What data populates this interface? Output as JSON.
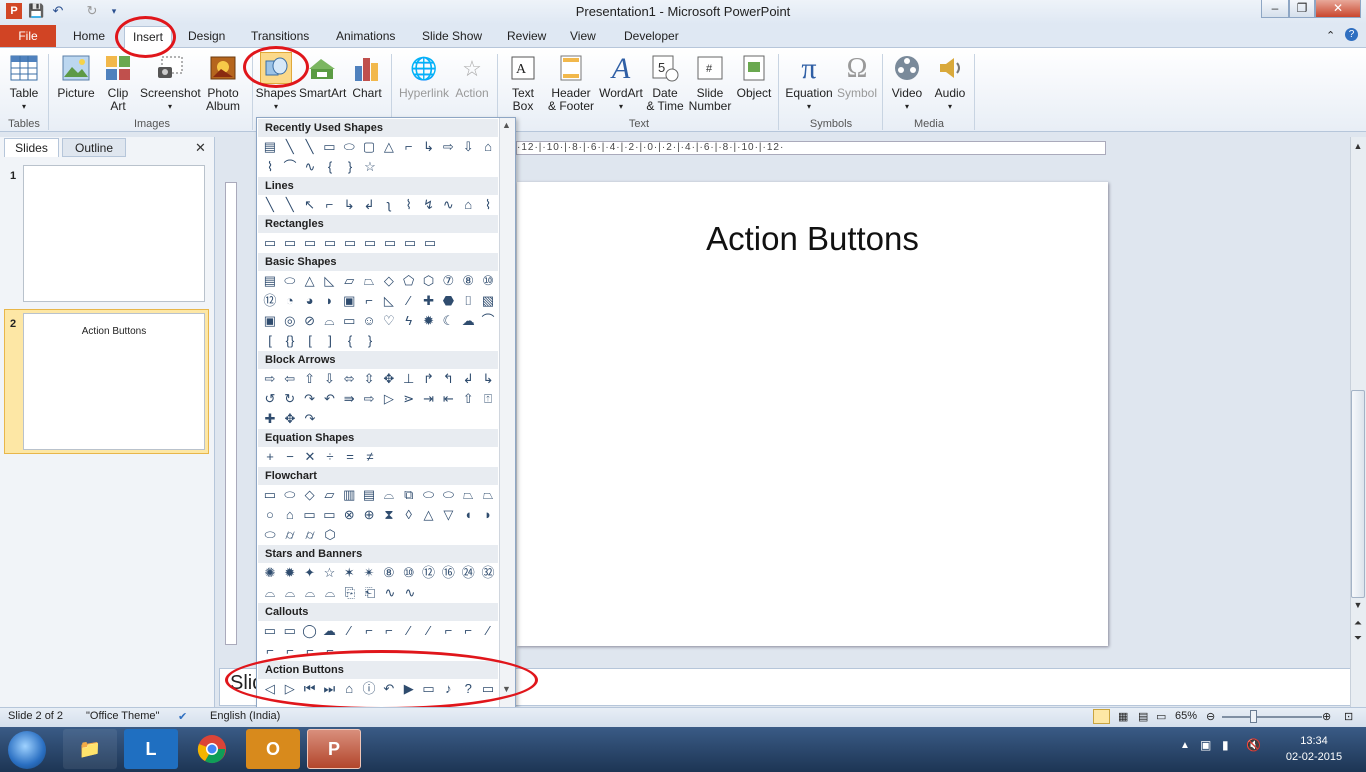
{
  "window": {
    "title": "Presentation1  -  Microsoft PowerPoint",
    "controls": [
      "–",
      "❐",
      "✕"
    ]
  },
  "tabs": [
    "File",
    "Home",
    "Insert",
    "Design",
    "Transitions",
    "Animations",
    "Slide Show",
    "Review",
    "View",
    "Developer"
  ],
  "ribbon": {
    "tables": {
      "label": "Table",
      "group": "Tables"
    },
    "images": {
      "picture": "Picture",
      "clipart_1": "Clip",
      "clipart_2": "Art",
      "screenshot": "Screenshot",
      "photo_1": "Photo",
      "photo_2": "Album",
      "group": "Images"
    },
    "illustrations": {
      "shapes": "Shapes",
      "smartart": "SmartArt",
      "chart": "Chart"
    },
    "links": {
      "hyperlink": "Hyperlink",
      "action": "Action"
    },
    "text": {
      "textbox_1": "Text",
      "textbox_2": "Box",
      "header_1": "Header",
      "header_2": "& Footer",
      "wordart": "WordArt",
      "date_1": "Date",
      "date_2": "& Time",
      "slidenum_1": "Slide",
      "slidenum_2": "Number",
      "object": "Object",
      "group": "Text"
    },
    "symbols": {
      "equation": "Equation",
      "symbol": "Symbol",
      "group": "Symbols"
    },
    "media": {
      "video": "Video",
      "audio": "Audio",
      "group": "Media"
    }
  },
  "shapes_menu": {
    "sections": {
      "recent": "Recently Used Shapes",
      "lines": "Lines",
      "rectangles": "Rectangles",
      "basic": "Basic Shapes",
      "block_arrows": "Block Arrows",
      "equation": "Equation Shapes",
      "flowchart": "Flowchart",
      "stars": "Stars and Banners",
      "callouts": "Callouts",
      "action": "Action Buttons"
    },
    "glyph_rows": {
      "recent_1": [
        "▤",
        "╲",
        "╲",
        "▭",
        "⬭",
        "▢",
        "△",
        "⌐",
        "↳",
        "⇨",
        "⇩",
        "⌂"
      ],
      "recent_2": [
        "⌇",
        "⌒",
        "∿",
        "{",
        "}",
        "☆"
      ],
      "lines_1": [
        "╲",
        "╲",
        "↖",
        "⌐",
        "↳",
        "↲",
        "ʅ",
        "⌇",
        "↯",
        "∿",
        "⌂",
        "⌇"
      ],
      "rect_1": [
        "▭",
        "▭",
        "▭",
        "▭",
        "▭",
        "▭",
        "▭",
        "▭",
        "▭"
      ],
      "basic_1": [
        "▤",
        "⬭",
        "△",
        "◺",
        "▱",
        "⏢",
        "◇",
        "⬠",
        "⬡",
        "⑦",
        "⑧",
        "⑩"
      ],
      "basic_2": [
        "⑫",
        "◔",
        "◕",
        "◗",
        "▣",
        "⌐",
        "◺",
        "⁄",
        "✚",
        "⬣",
        "⌷",
        "▧"
      ],
      "basic_3": [
        "▣",
        "◎",
        "⊘",
        "⌓",
        "▭",
        "☺",
        "♡",
        "ϟ",
        "✹",
        "☾",
        "☁",
        "⌒"
      ],
      "basic_4": [
        "[",
        "{}",
        "[",
        "]",
        "{",
        "}"
      ],
      "arrows_1": [
        "⇨",
        "⇦",
        "⇧",
        "⇩",
        "⬄",
        "⇳",
        "✥",
        "⊥",
        "↱",
        "↰",
        "↲",
        "↳"
      ],
      "arrows_2": [
        "↺",
        "↻",
        "↷",
        "↶",
        "⇛",
        "⇨",
        "▷",
        "⋗",
        "⇥",
        "⇤",
        "⇧",
        "⍐"
      ],
      "arrows_3": [
        "✚",
        "✥",
        "↷"
      ],
      "eq_1": [
        "+",
        "−",
        "✕",
        "÷",
        "=",
        "≠"
      ],
      "flow_1": [
        "▭",
        "⬭",
        "◇",
        "▱",
        "▥",
        "▤",
        "⌓",
        "⧉",
        "⬭",
        "⬭",
        "⏢",
        "⏢"
      ],
      "flow_2": [
        "○",
        "⌂",
        "▭",
        "▭",
        "⊗",
        "⊕",
        "⧗",
        "◊",
        "△",
        "▽",
        "◖",
        "◗"
      ],
      "flow_3": [
        "⬭",
        "⌭",
        "⌭",
        "⬡"
      ],
      "stars_1": [
        "✺",
        "✹",
        "✦",
        "☆",
        "✶",
        "✴",
        "⑧",
        "⑩",
        "⑫",
        "⑯",
        "㉔",
        "㉜"
      ],
      "stars_2": [
        "⌓",
        "⌓",
        "⌓",
        "⌓",
        "⎘",
        "⎗",
        "∿",
        "∿"
      ],
      "callouts_1": [
        "▭",
        "▭",
        "◯",
        "☁",
        "⁄",
        "⌐",
        "⌐",
        "⁄",
        "⁄",
        "⌐",
        "⌐",
        "⁄"
      ],
      "callouts_2": [
        "⌐",
        "⌐",
        "⌐",
        "⌐"
      ],
      "action_1": [
        "◁",
        "▷",
        "⏮",
        "⏭",
        "⌂",
        "ⓘ",
        "↶",
        "▶",
        "▭",
        "♪",
        "?",
        "▭"
      ]
    }
  },
  "slides_panel": {
    "tab_slides": "Slides",
    "tab_outline": "Outline",
    "close": "✕",
    "slide_1": "1",
    "slide_2": "2",
    "slide_2_title": "Action Buttons"
  },
  "ruler": {
    "marks": "·12·|·10·|·8·|·6·|·4·|·2·|·0·|·2·|·4·|·6·|·8·|·10·|·12·"
  },
  "slide": {
    "title": "Action Buttons"
  },
  "notes": {
    "text": "Slid"
  },
  "status": {
    "slide_info": "Slide 2 of 2",
    "theme": "\"Office Theme\"",
    "language": "English (India)",
    "zoom": "65%"
  },
  "taskbar": {
    "time": "13:34",
    "date": "02-02-2015"
  }
}
